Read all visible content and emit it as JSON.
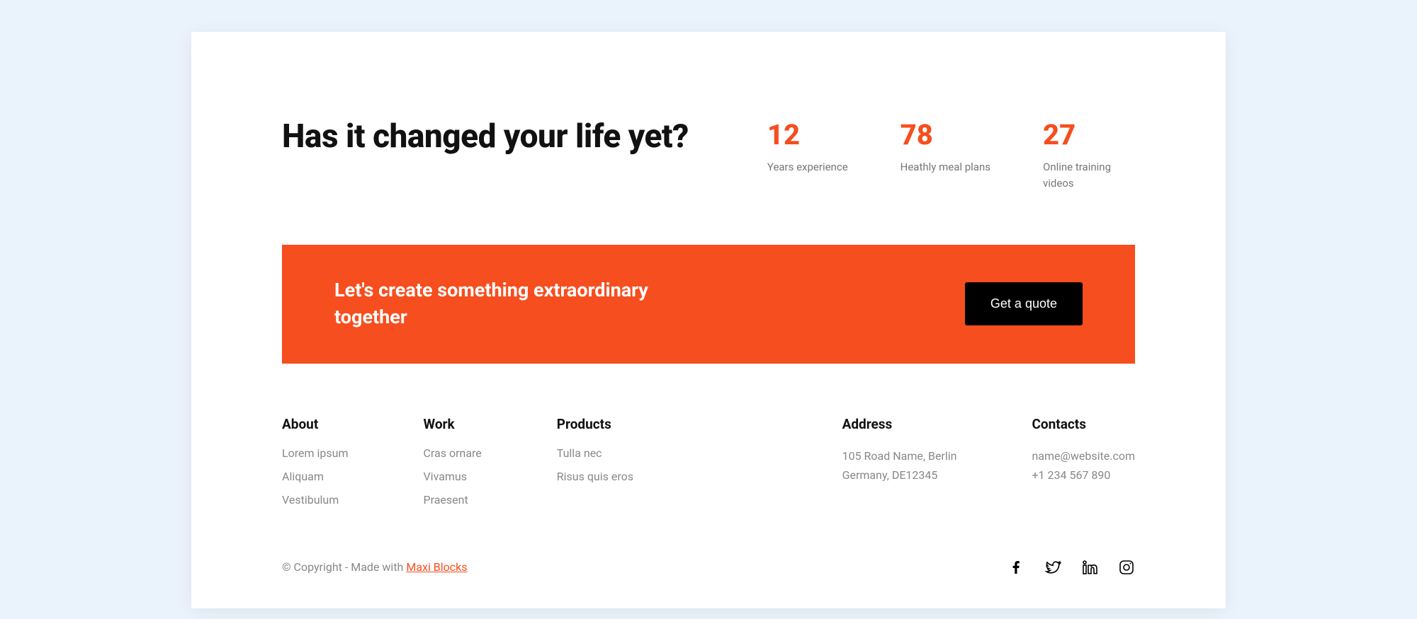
{
  "headline": "Has it changed your life yet?",
  "stats": [
    {
      "value": "12",
      "label": "Years experience"
    },
    {
      "value": "78",
      "label": "Heathly meal plans"
    },
    {
      "value": "27",
      "label": "Online training videos"
    }
  ],
  "cta": {
    "title": "Let's create something extraordinary together",
    "button": "Get a quote"
  },
  "footer": {
    "about": {
      "heading": "About",
      "links": [
        "Lorem ipsum",
        "Aliquam",
        "Vestibulum"
      ]
    },
    "work": {
      "heading": "Work",
      "links": [
        "Cras ornare",
        "Vivamus",
        "Praesent"
      ]
    },
    "products": {
      "heading": "Products",
      "links": [
        "Tulla nec",
        "Risus quis eros"
      ]
    },
    "address": {
      "heading": "Address",
      "line1": "105 Road Name, Berlin",
      "line2": "Germany, DE12345"
    },
    "contacts": {
      "heading": "Contacts",
      "email": "name@website.com",
      "phone": "+1 234 567 890"
    }
  },
  "copyright": {
    "prefix": "© Copyright - Made with ",
    "link_text": "Maxi Blocks"
  },
  "social": [
    "facebook",
    "twitter",
    "linkedin",
    "instagram"
  ]
}
